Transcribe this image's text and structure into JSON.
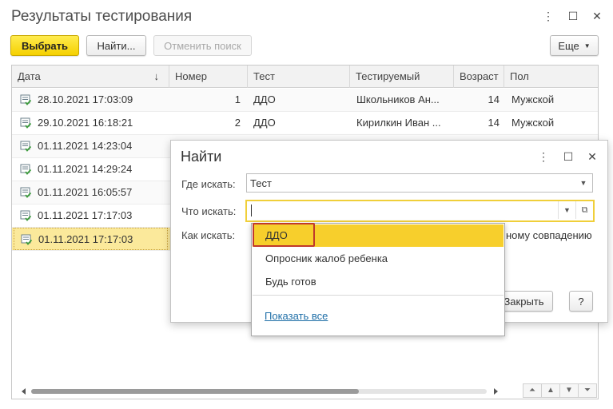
{
  "window": {
    "title": "Результаты тестирования",
    "controls": {
      "more": "⋮",
      "maximize": "☐",
      "close": "✕"
    }
  },
  "toolbar": {
    "select_label": "Выбрать",
    "find_label": "Найти...",
    "cancel_search_label": "Отменить поиск",
    "more_label": "Еще"
  },
  "table": {
    "columns": [
      "Дата",
      "Номер",
      "Тест",
      "Тестируемый",
      "Возраст",
      "Пол"
    ],
    "sort_indicator": "↓",
    "rows": [
      {
        "date": "28.10.2021 17:03:09",
        "number": "1",
        "test": "ДДО",
        "person": "Школьников Ан...",
        "age": "14",
        "sex": "Мужской"
      },
      {
        "date": "29.10.2021 16:18:21",
        "number": "2",
        "test": "ДДО",
        "person": "Кирилкин Иван ...",
        "age": "14",
        "sex": "Мужской"
      },
      {
        "date": "01.11.2021 14:23:04",
        "number": "",
        "test": "",
        "person": "",
        "age": "",
        "sex": ""
      },
      {
        "date": "01.11.2021 14:29:24",
        "number": "",
        "test": "",
        "person": "",
        "age": "",
        "sex": ""
      },
      {
        "date": "01.11.2021 16:05:57",
        "number": "",
        "test": "",
        "person": "",
        "age": "",
        "sex": ""
      },
      {
        "date": "01.11.2021 17:17:03",
        "number": "",
        "test": "",
        "person": "",
        "age": "",
        "sex": ""
      },
      {
        "date": "01.11.2021 17:17:03",
        "number": "",
        "test": "",
        "person": "",
        "age": "",
        "sex": ""
      }
    ],
    "selected_row": 6
  },
  "dialog": {
    "title": "Найти",
    "where_label": "Где искать:",
    "where_value": "Тест",
    "what_label": "Что искать:",
    "what_value": "",
    "how_label": "Как искать:",
    "how_partial": "ному совпадению",
    "close_label": "Закрыть",
    "help_label": "?"
  },
  "dropdown": {
    "items": [
      "ДДО",
      "Опросник жалоб ребенка",
      "Будь готов"
    ],
    "highlighted": 0,
    "show_all_label": "Показать все"
  },
  "colors": {
    "accent_yellow": "#f5d000",
    "selected_row": "#fbe99b",
    "highlight_item": "#f7cf2c",
    "red_annotation": "#c0392b",
    "link": "#1e6ea7"
  }
}
